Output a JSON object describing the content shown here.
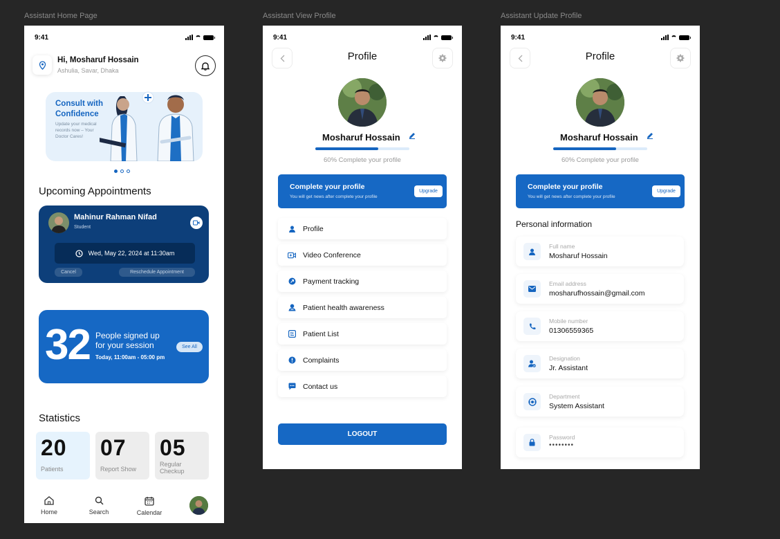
{
  "frames": {
    "home": "Assistant Home Page",
    "view": "Assistant View Profile",
    "update": "Assistant Update Profile"
  },
  "status_time": "9:41",
  "home": {
    "greeting": "Hi, Mosharuf Hossain",
    "address": "Ashulia, Savar, Dhaka",
    "banner": {
      "title": "Consult with Confidence",
      "text": "Update your medical records now – Your Doctor Cares!"
    },
    "upcoming_title": "Upcoming Appointments",
    "appointment": {
      "name": "Mahinur Rahman Nifad",
      "role": "Student",
      "datetime": "Wed, May 22, 2024 at 11:30am",
      "cancel": "Cancel",
      "reschedule": "Reschedule Appointment"
    },
    "signup": {
      "count": "32",
      "text": "People signed up for your session",
      "time": "Today, 11:00am - 05:00 pm",
      "see_all": "See All"
    },
    "statistics_title": "Statistics",
    "stats": [
      {
        "num": "20",
        "label": "Patients",
        "bg": "#e6f3fd"
      },
      {
        "num": "07",
        "label": "Report Show",
        "bg": "#ededed"
      },
      {
        "num": "05",
        "label": "Regular Checkup",
        "bg": "#ededed"
      }
    ],
    "nav": [
      "Home",
      "Search",
      "Calendar"
    ]
  },
  "profile": {
    "title": "Profile",
    "name": "Mosharuf Hossain",
    "progress_pct": 67,
    "pct_text": "60% Complete your profile",
    "complete_title": "Complete your profile",
    "complete_sub": "You will get news after complete your profile",
    "upgrade": "Upgrade"
  },
  "menu": [
    {
      "label": "Profile",
      "icon": "user-icon"
    },
    {
      "label": "Video Conference",
      "icon": "video-icon"
    },
    {
      "label": "Payment tracking",
      "icon": "payment-icon"
    },
    {
      "label": "Patient health awareness",
      "icon": "health-icon"
    },
    {
      "label": "Patient List",
      "icon": "list-icon"
    },
    {
      "label": "Complaints",
      "icon": "complaint-icon"
    },
    {
      "label": "Contact us",
      "icon": "chat-icon"
    }
  ],
  "logout": "LOGOUT",
  "personal_title": "Personal information",
  "fields": [
    {
      "label": "Full name",
      "value": "Mosharuf Hossain",
      "icon": "user-icon"
    },
    {
      "label": "Email address",
      "value": "mosharufhossain@gmail.com",
      "icon": "mail-icon"
    },
    {
      "label": "Mobile number",
      "value": "01306559365",
      "icon": "phone-icon"
    },
    {
      "label": "Designation",
      "value": "Jr. Assistant",
      "icon": "designation-icon"
    },
    {
      "label": "Department",
      "value": "System Assistant",
      "icon": "department-icon"
    },
    {
      "label": "Password",
      "value": "••••••••",
      "icon": "lock-icon"
    }
  ]
}
